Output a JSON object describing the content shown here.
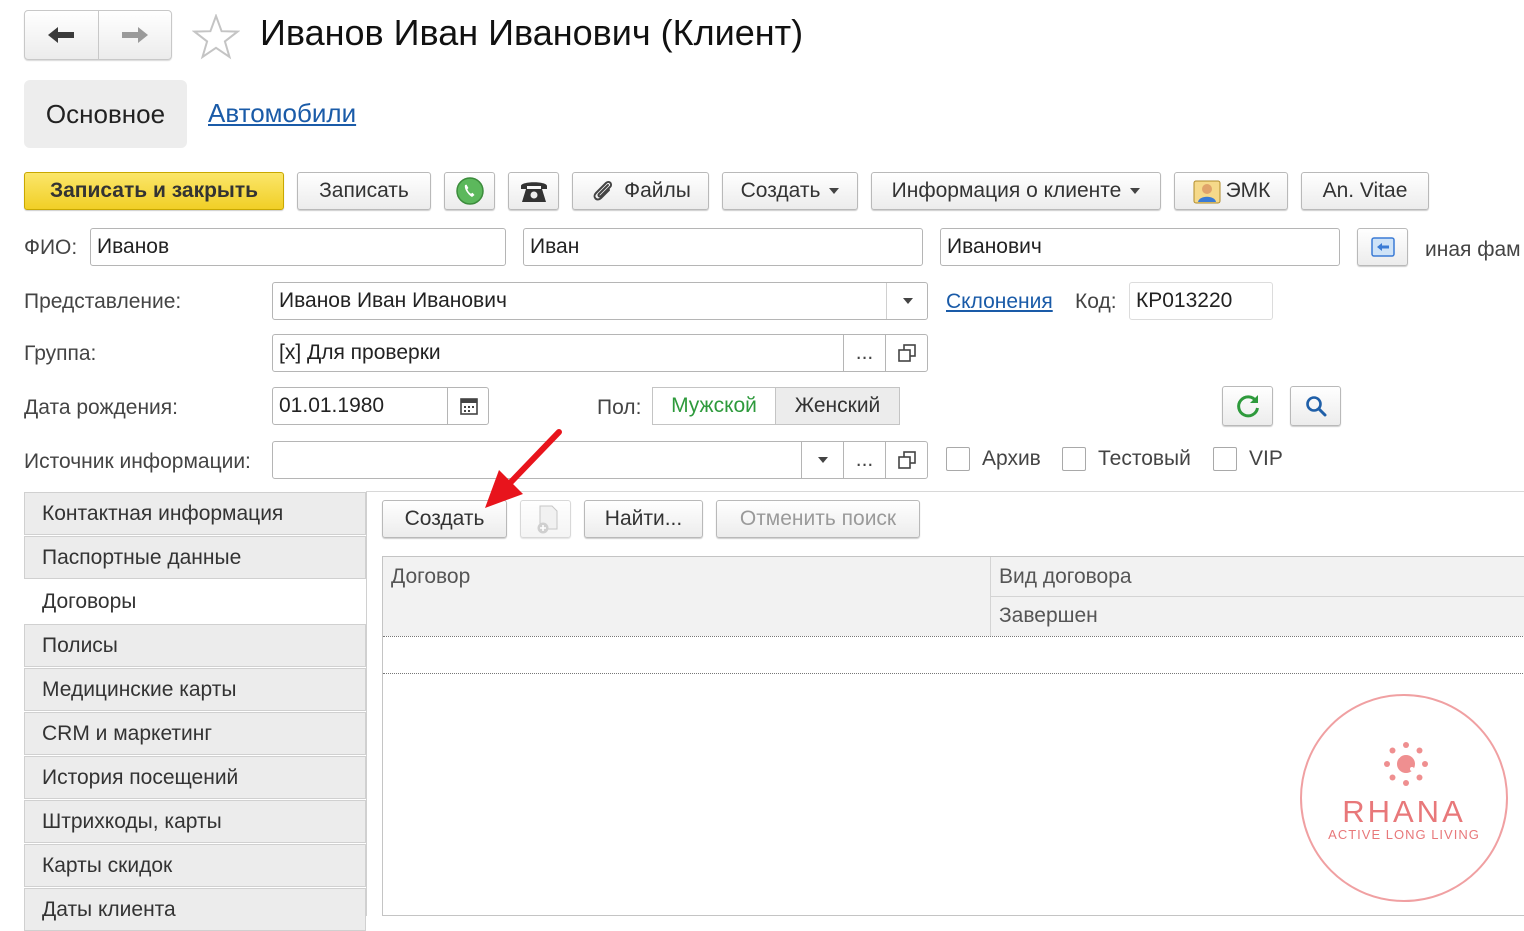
{
  "window": {
    "title": "Иванов Иван Иванович (Клиент)"
  },
  "tabs": [
    {
      "label": "Основное",
      "active": true
    },
    {
      "label": "Автомобили",
      "active": false
    }
  ],
  "toolbar": {
    "save_close": "Записать и закрыть",
    "save": "Записать",
    "files": "Файлы",
    "create": "Создать",
    "client_info": "Информация о клиенте",
    "emk": "ЭМК",
    "an_vitae": "An. Vitae"
  },
  "form": {
    "fio_label": "ФИО:",
    "last_name": "Иванов",
    "first_name": "Иван",
    "middle_name": "Иванович",
    "other_surname": "иная фам",
    "presentation_label": "Представление:",
    "presentation_value": "Иванов Иван Иванович",
    "declensions_link": "Склонения",
    "code_label": "Код:",
    "code_value": "КР013220",
    "group_label": "Группа:",
    "group_value": "[x] Для проверки",
    "birth_label": "Дата рождения:",
    "birth_value": "01.01.1980",
    "gender_label": "Пол:",
    "gender_male": "Мужской",
    "gender_female": "Женский",
    "gender_selected": "Мужской",
    "source_label": "Источник информации:",
    "source_value": "",
    "archive_label": "Архив",
    "test_label": "Тестовый",
    "vip_label": "VIP",
    "ellipsis": "..."
  },
  "side_nav": [
    {
      "label": "Контактная информация",
      "active": false
    },
    {
      "label": "Паспортные данные",
      "active": false
    },
    {
      "label": "Договоры",
      "active": true
    },
    {
      "label": "Полисы",
      "active": false
    },
    {
      "label": "Медицинские карты",
      "active": false
    },
    {
      "label": "CRM и маркетинг",
      "active": false
    },
    {
      "label": "История посещений",
      "active": false
    },
    {
      "label": "Штрихкоды, карты",
      "active": false
    },
    {
      "label": "Карты скидок",
      "active": false
    },
    {
      "label": "Даты клиента",
      "active": false
    }
  ],
  "contracts": {
    "create": "Создать",
    "find": "Найти...",
    "cancel_search": "Отменить поиск",
    "columns": {
      "contract": "Договор",
      "contract_type": "Вид договора",
      "completed": "Завершен"
    },
    "rows": []
  },
  "watermark": {
    "brand": "RHANA",
    "tagline": "ACTIVE LONG LIVING"
  },
  "colors": {
    "primary_button": "#f3d42f",
    "link": "#1a5ba8",
    "gender_selected": "#2e9a3c",
    "arrow": "#e8141c",
    "watermark": "#e8787a"
  }
}
